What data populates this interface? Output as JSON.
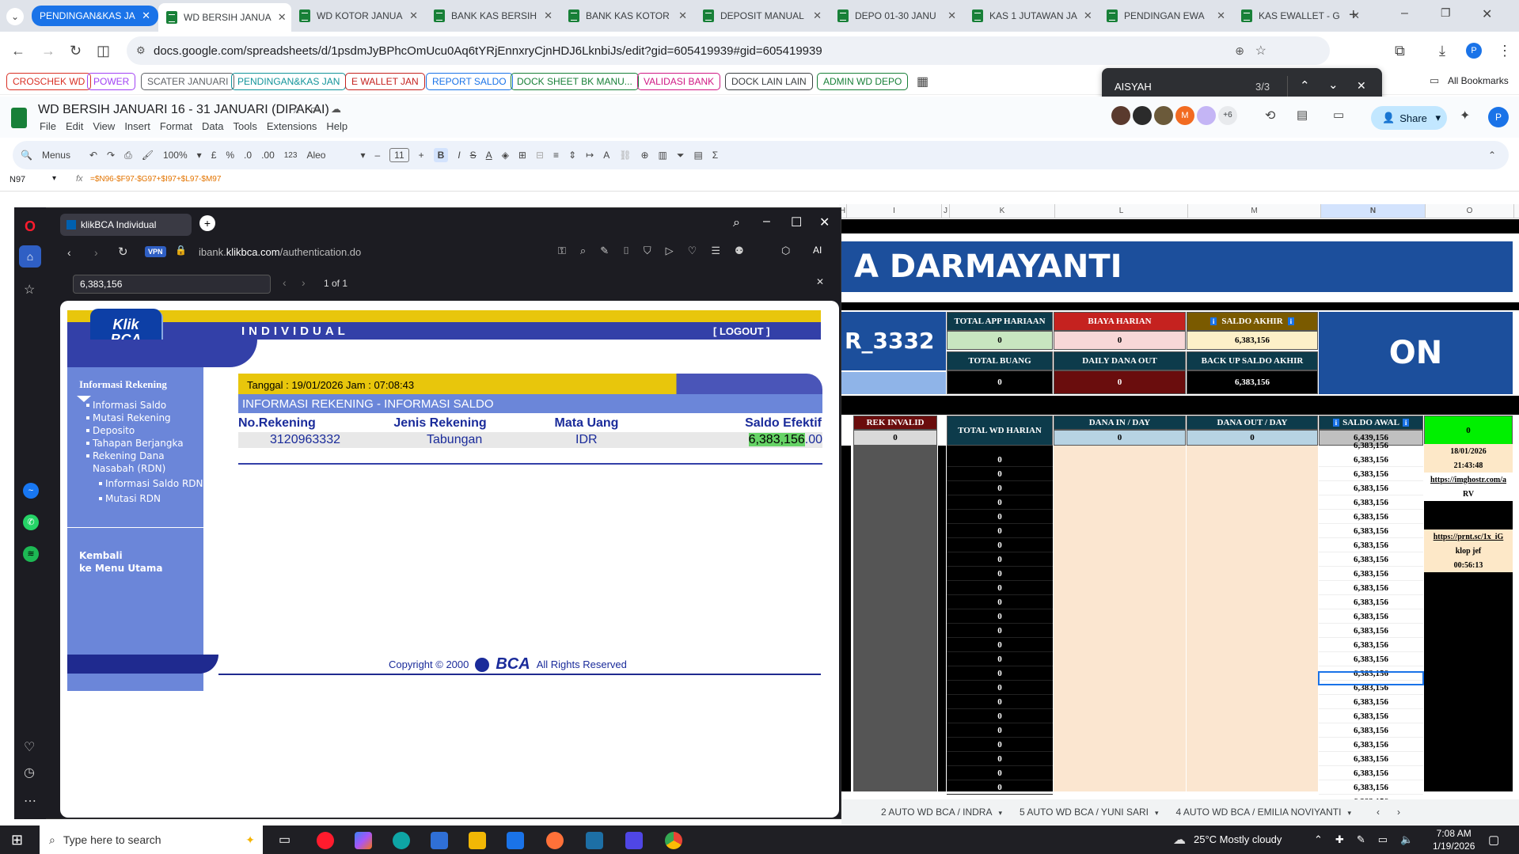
{
  "chrome": {
    "tabs": [
      {
        "label": "PENDINGAN&KAS JA",
        "active": false
      },
      {
        "label": "WD BERSIH JANUA",
        "active": true
      },
      {
        "label": "WD KOTOR JANUA",
        "active": false
      },
      {
        "label": "BANK KAS BERSIH",
        "active": false
      },
      {
        "label": "BANK KAS KOTOR",
        "active": false
      },
      {
        "label": "DEPOSIT MANUAL",
        "active": false
      },
      {
        "label": "DEPO 01-30 JANU",
        "active": false
      },
      {
        "label": "KAS 1 JUTAWAN JA",
        "active": false
      },
      {
        "label": "PENDINGAN EWA",
        "active": false
      },
      {
        "label": "KAS EWALLET - G",
        "active": false
      }
    ],
    "url": "docs.google.com/spreadsheets/d/1psdmJyBPhcOmUcu0Aq6tYRjEnnxryCjnHDJ6LknbiJs/edit?gid=605419939#gid=605419939",
    "profile_initial": "P",
    "bookmarks": [
      {
        "label": "CROSCHEK WD",
        "color": "#d93025"
      },
      {
        "label": "POWER",
        "color": "#a142f4"
      },
      {
        "label": "SCATER JANUARI",
        "color": "#5f6368"
      },
      {
        "label": "PENDINGAN&KAS JAN",
        "color": "#12939a"
      },
      {
        "label": "E WALLET JAN",
        "color": "#c5221f"
      },
      {
        "label": "REPORT SALDO",
        "color": "#1a73e8"
      },
      {
        "label": "DOCK SHEET BK MANU...",
        "color": "#188038"
      },
      {
        "label": "VALIDASI BANK",
        "color": "#d01884"
      },
      {
        "label": "DOCK LAIN LAIN",
        "color": "#3c4043"
      },
      {
        "label": "ADMIN WD DEPO",
        "color": "#188038"
      }
    ],
    "all_bookmarks": "All Bookmarks",
    "find": {
      "query": "AISYAH",
      "count": "3/3"
    }
  },
  "sheets": {
    "doc_title": "WD BERSIH JANUARI 16 - 31 JANUARI (DIPAKAI)",
    "menus": [
      "File",
      "Edit",
      "View",
      "Insert",
      "Format",
      "Data",
      "Tools",
      "Extensions",
      "Help"
    ],
    "share_label": "Share",
    "avatar_extra": "+6",
    "toolbar": {
      "menus_label": "Menus",
      "zoom": "100%",
      "currency": "£",
      "percent": "%",
      "dec_less": ".0",
      "dec_more": ".00",
      "number_fmt": "123",
      "font": "Aleo",
      "font_size": "11"
    },
    "name_box": "N97",
    "formula": "=$N96-$F97-$G97+$I97+$L97-$M97",
    "col_headers": [
      "H",
      "I",
      "J",
      "K",
      "L",
      "M",
      "N",
      "O"
    ],
    "banner_name": "A DARMAYANTI",
    "account_suffix": "R_3332",
    "summary": {
      "total_app_harian_label": "TOTAL APP HARIAAN",
      "total_app_harian": "0",
      "biaya_harian_label": "BIAYA HARIAN",
      "biaya_harian": "0",
      "saldo_akhir_label": "SALDO AKHIR",
      "saldo_akhir": "6,383,156",
      "total_buang_label": "TOTAL BUANG",
      "total_buang": "0",
      "daily_dana_out_label": "DAILY DANA OUT",
      "daily_dana_out": "0",
      "backup_saldo_label": "BACK UP SALDO AKHIR",
      "backup_saldo": "6,383,156",
      "status": "ON"
    },
    "table_headers": {
      "rek_invalid": "REK INVALID",
      "rek_invalid_val": "0",
      "total_wd_harian": "TOTAL WD HARIAN",
      "dana_in": "DANA IN / DAY",
      "dana_in_val": "0",
      "dana_out": "DANA OUT / DAY",
      "dana_out_val": "0",
      "saldo_awal": "SALDO AWAL",
      "saldo_awal_val": "6,439,156",
      "green_val": "0"
    },
    "rows_k": [
      "0",
      "0",
      "0",
      "0",
      "0",
      "0",
      "0",
      "0",
      "0",
      "0",
      "0",
      "0",
      "0",
      "0",
      "0",
      "0",
      "0",
      "0",
      "0",
      "0",
      "0",
      "0",
      "0",
      "0",
      "0"
    ],
    "rows_n": [
      "6,383,156",
      "6,383,156",
      "6,383,156",
      "6,383,156",
      "6,383,156",
      "6,383,156",
      "6,383,156",
      "6,383,156",
      "6,383,156",
      "6,383,156",
      "6,383,156",
      "6,383,156",
      "6,383,156",
      "6,383,156",
      "6,383,156",
      "6,383,156",
      "6,383,156",
      "6,383,156",
      "6,383,156",
      "6,383,156",
      "6,383,156",
      "6,383,156",
      "6,383,156",
      "6,383,156",
      "6,383,156"
    ],
    "top_cut_n": "6,383,156",
    "col_o_notes": [
      "18/01/2026",
      "21:43:48",
      "https://imghostr.com/a",
      "RV",
      "",
      "",
      "https://prnt.sc/1x_iG",
      "klop jef",
      "00:56:13"
    ],
    "sheet_tabs": [
      "2  AUTO WD BCA / INDRA",
      "5  AUTO WD BCA / YUNI SARI",
      "4  AUTO WD BCA / EMILIA NOVIYANTI"
    ]
  },
  "opera": {
    "tab_title": "klikBCA Individual",
    "url_prefix": "ibank.",
    "url_domain": "klikbca.com",
    "url_path": "/authentication.do",
    "vpn": "VPN",
    "find_query": "6,383,156",
    "find_count": "1 of 1",
    "ai_label": "AI"
  },
  "klikbca": {
    "logo_top": "Klik",
    "logo_bottom": "BCA",
    "individual": "INDIVIDUAL",
    "logout": "[ LOGOUT ]",
    "sidebar_title": "Informasi Rekening",
    "menu": [
      "Informasi Saldo",
      "Mutasi Rekening",
      "Deposito",
      "Tahapan Berjangka",
      "Rekening Dana Nasabah (RDN)"
    ],
    "submenu": [
      "Informasi Saldo RDN",
      "Mutasi RDN"
    ],
    "back_1": "Kembali",
    "back_2": "ke Menu Utama",
    "date_line": "Tanggal : 19/01/2026 Jam : 07:08:43",
    "section_title": "INFORMASI REKENING - INFORMASI SALDO",
    "headers": [
      "No.Rekening",
      "Jenis Rekening",
      "Mata Uang",
      "Saldo Efektif"
    ],
    "row": {
      "no": "3120963332",
      "jenis": "Tabungan",
      "mata_uang": "IDR",
      "saldo_main": "6,383,156",
      "saldo_dec": ".00"
    },
    "copyright": "Copyright © 2000",
    "bca": "BCA",
    "rights": "All Rights Reserved"
  },
  "taskbar": {
    "search_placeholder": "Type here to search",
    "weather": "25°C  Mostly cloudy",
    "time": "7:08 AM",
    "date": "1/19/2026"
  }
}
